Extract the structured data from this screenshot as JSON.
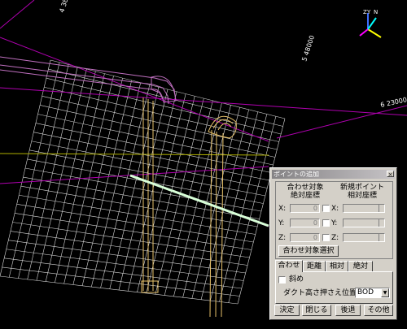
{
  "viewport": {
    "grid_labels": [
      "4 38000",
      "5 48000",
      "6 23000"
    ],
    "axes": {
      "z": "Z",
      "y": "Y",
      "n": "N"
    }
  },
  "dialog": {
    "title": "ポイントの追加",
    "close_label": "×",
    "left_header": [
      "合わせ対象",
      "絶対座標"
    ],
    "right_header": [
      "新規ポイント",
      "相対座標"
    ],
    "rows": [
      {
        "axis": "X:",
        "left_value": "0",
        "right_axis": "X:",
        "right_value": "0"
      },
      {
        "axis": "Y:",
        "left_value": "0",
        "right_axis": "Y:",
        "right_value": "0"
      },
      {
        "axis": "Z:",
        "left_value": "0",
        "right_axis": "Z:",
        "right_value": "0"
      }
    ],
    "select_target_button": "合わせ対象選択",
    "tabs": [
      "合わせ",
      "距離",
      "相対",
      "絶対"
    ],
    "selected_tab": "合わせ",
    "diagonal_label": "斜め",
    "duct_label": "ダクト高さ押さえ位置:",
    "duct_value": "BOD",
    "buttons": {
      "ok": "決定",
      "close": "閉じる",
      "back": "後退",
      "other": "その他"
    }
  },
  "colors": {
    "background": "#000000",
    "grid": "#d8d8d8",
    "duct": "#e8c26a",
    "magenta_line": "#b000b0",
    "highlight": "#ffffff",
    "dialog_bg": "#d4d0c8"
  }
}
